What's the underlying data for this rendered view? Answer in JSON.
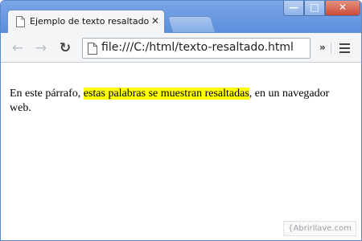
{
  "tab": {
    "title": "Ejemplo de texto resaltado",
    "close_icon": "close-icon",
    "page_icon": "page-icon"
  },
  "window_controls": {
    "minimize": "—",
    "maximize": "□",
    "close": "✕"
  },
  "toolbar": {
    "back": "←",
    "forward": "→",
    "reload": "↻",
    "url": "file:///C:/html/texto-resaltado.html",
    "overflow": "»"
  },
  "content": {
    "before": "En este párrafo, ",
    "highlighted": "estas palabras se muestran resaltadas",
    "after": ", en un navegador web."
  },
  "watermark": "{Abrirllave.com",
  "colors": {
    "highlight": "#ffff00",
    "frame": "#5b8fdc"
  }
}
